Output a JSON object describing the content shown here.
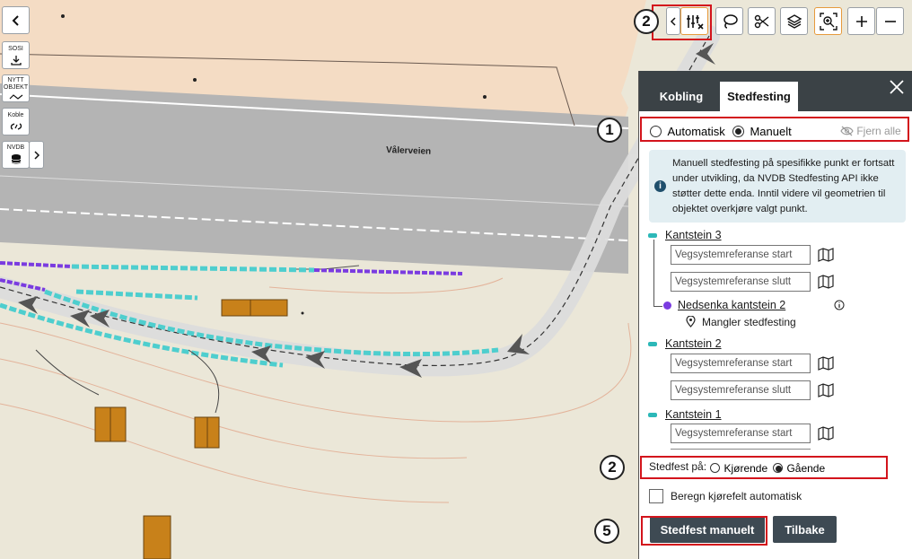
{
  "map": {
    "road_name": "Vålerveien",
    "colors": {
      "base": "#ebe7d8",
      "zone": "#f4dcc4",
      "road": "#b4b4b4",
      "route": "#dcdcdc",
      "cyan": "#4ecece",
      "purple": "#7a3be0",
      "building": "#c8811a"
    }
  },
  "sidebar": {
    "back_icon": "chevron-left-icon",
    "items": [
      {
        "label": "SOSI",
        "icon": "download-icon"
      },
      {
        "label": "NYTT\nOBJEKT",
        "icon": "polyline-icon"
      },
      {
        "label": "Koble",
        "icon": "link-icon"
      },
      {
        "label": "NVDB",
        "icon": "database-icon"
      }
    ]
  },
  "toolbar": {
    "icons": [
      "chevron-left-icon",
      "sliders-close-icon",
      "lasso-icon",
      "scissors-icon",
      "layers-icon",
      "zoom-extent-icon",
      "plus-icon",
      "minus-icon"
    ]
  },
  "callouts": {
    "a": "2",
    "b": "1",
    "c": "2",
    "d": "5"
  },
  "panel": {
    "tabs": [
      "Kobling",
      "Stedfesting"
    ],
    "active_tab": "Stedfesting",
    "mode_options": [
      "Automatisk",
      "Manuelt"
    ],
    "mode_selected": "Manuelt",
    "clear_all": "Fjern alle",
    "info_text": "Manuell stedfesting på spesifikke punkt er fortsatt under utvikling, da NVDB Stedfesting API ikke støtter dette enda. Inntil videre vil geometrien til objektet overkjøre valgt punkt.",
    "input_placeholder_start": "Vegsystemreferanse start",
    "input_placeholder_end": "Vegsystemreferanse slutt",
    "segments": [
      {
        "name": "Kantstein 3"
      },
      {
        "name": "Nedsenka kantstein 2",
        "status": "Mangler stedfesting"
      },
      {
        "name": "Kantstein 2"
      },
      {
        "name": "Kantstein 1"
      }
    ],
    "stedfest_label": "Stedfest på:",
    "stedfest_options": [
      "Kjørende",
      "Gående"
    ],
    "stedfest_selected": "Gående",
    "auto_lane_label": "Beregn kjørefelt automatisk",
    "primary_button": "Stedfest manuelt",
    "secondary_button": "Tilbake"
  }
}
